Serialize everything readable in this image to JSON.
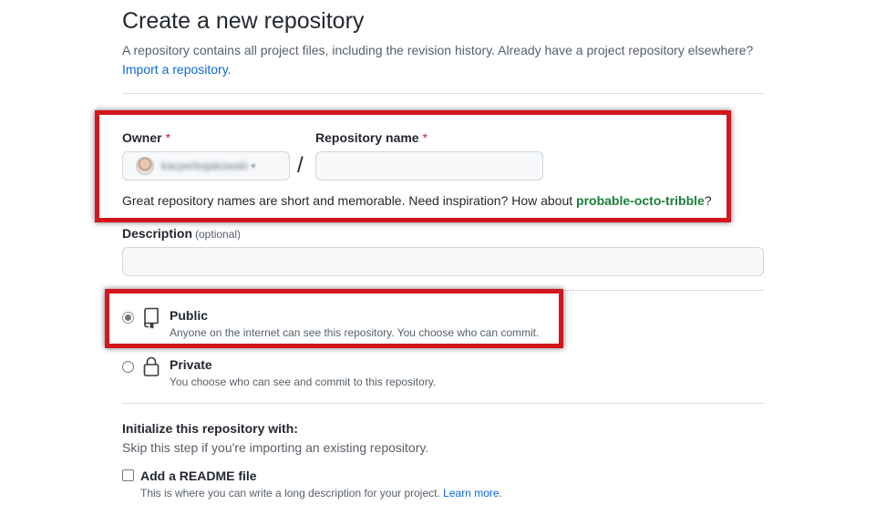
{
  "header": {
    "title": "Create a new repository",
    "subtitle": "A repository contains all project files, including the revision history. Already have a project repository elsewhere?",
    "import_link": "Import a repository",
    "import_suffix": "."
  },
  "owner": {
    "label": "Owner",
    "required_mark": "*",
    "value": "kacperbojakowski",
    "caret": "▾"
  },
  "repo_name": {
    "label": "Repository name",
    "required_mark": "*",
    "separator": "/",
    "value": "",
    "placeholder": ""
  },
  "name_hint": {
    "text": "Great repository names are short and memorable. Need inspiration? How about ",
    "suggestion": "probable-octo-tribble",
    "suffix": "?"
  },
  "description": {
    "label": "Description",
    "optional": "(optional)",
    "value": "",
    "placeholder": ""
  },
  "visibility": {
    "public": {
      "title": "Public",
      "description": "Anyone on the internet can see this repository. You choose who can commit.",
      "icon": "repo-icon",
      "selected": true
    },
    "private": {
      "title": "Private",
      "description": "You choose who can see and commit to this repository.",
      "icon": "lock-icon",
      "selected": false
    }
  },
  "initialize": {
    "title": "Initialize this repository with:",
    "subtitle": "Skip this step if you're importing an existing repository.",
    "readme": {
      "label": "Add a README file",
      "description": "This is where you can write a long description for your project.",
      "learn_more": "Learn more",
      "suffix": ".",
      "checked": false
    }
  },
  "colors": {
    "highlight": "#d3161d",
    "link": "#0969da",
    "suggestion": "#1a7f37",
    "required": "#cf222e"
  }
}
